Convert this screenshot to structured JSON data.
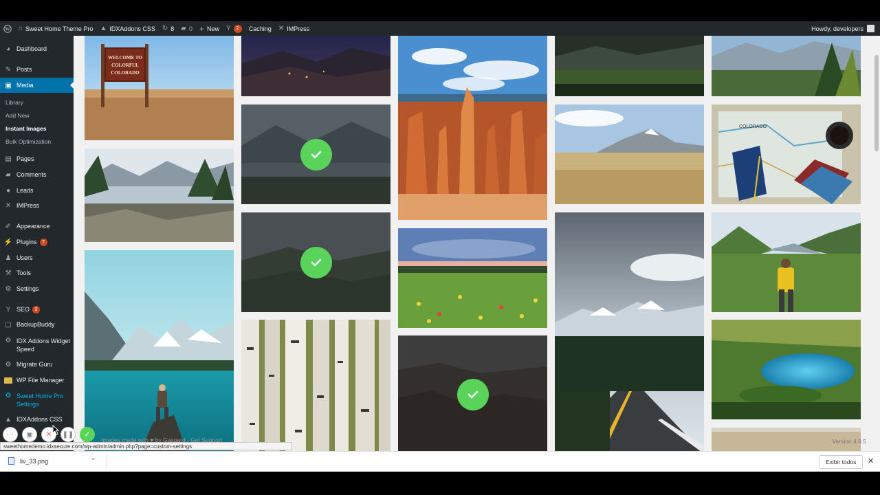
{
  "adminbar": {
    "wp_logo": "wordpress-icon",
    "site_name": "Sweet Home Theme Pro",
    "idx_addons": "IDXAddons CSS",
    "updates_count": "8",
    "comments_count": "0",
    "new_label": "New",
    "yoast_badge": "2",
    "caching": "Caching",
    "impress": "IMPress",
    "howdy": "Howdy, developers"
  },
  "sidebar": {
    "dashboard": "Dashboard",
    "posts": "Posts",
    "media": "Media",
    "media_sub": [
      "Library",
      "Add New",
      "Instant Images",
      "Bulk Optimization"
    ],
    "pages": "Pages",
    "comments": "Comments",
    "leads": "Leads",
    "impress": "IMPress",
    "appearance": "Appearance",
    "plugins": "Plugins",
    "plugins_badge": "7",
    "users": "Users",
    "tools": "Tools",
    "settings": "Settings",
    "seo": "SEO",
    "seo_badge": "2",
    "backupbuddy": "BackupBuddy",
    "idx_widget_speed": "IDX Addons Widget Speed",
    "migrate_guru": "Migrate Guru",
    "wp_file_manager": "WP File Manager",
    "sweet_home_settings": "Sweet Home Pro Settings",
    "idxaddons_css": "IDXAddons CSS"
  },
  "gallery": {
    "selected_count": 3,
    "images": [
      "colorado-welcome-sign",
      "night-valley",
      "bryce-canyon-hoodoos",
      "dark-forest-meadow",
      "mountain-forest-pines",
      "mountain-lake-selected",
      "mountain-meadow-grass",
      "colorado-map-journal",
      "mountain-lake-pines",
      "hills-selected",
      "wildflower-meadow",
      "storm-clouds-road",
      "hiker-valley",
      "moraine-lake-hiker",
      "aspen-trunks",
      "canyon-selected",
      "alpine-blue-lake"
    ]
  },
  "footer": {
    "credit": "Images made with ♥ by Gaspard - Get Support",
    "version": "Version 4.9.5"
  },
  "status_url": "sweethomedemo.idxsecure.com/wp-admin/admin.php?page=custom-settings",
  "download": {
    "filename": "liv_33.png",
    "show_all": "Exibir todos"
  }
}
